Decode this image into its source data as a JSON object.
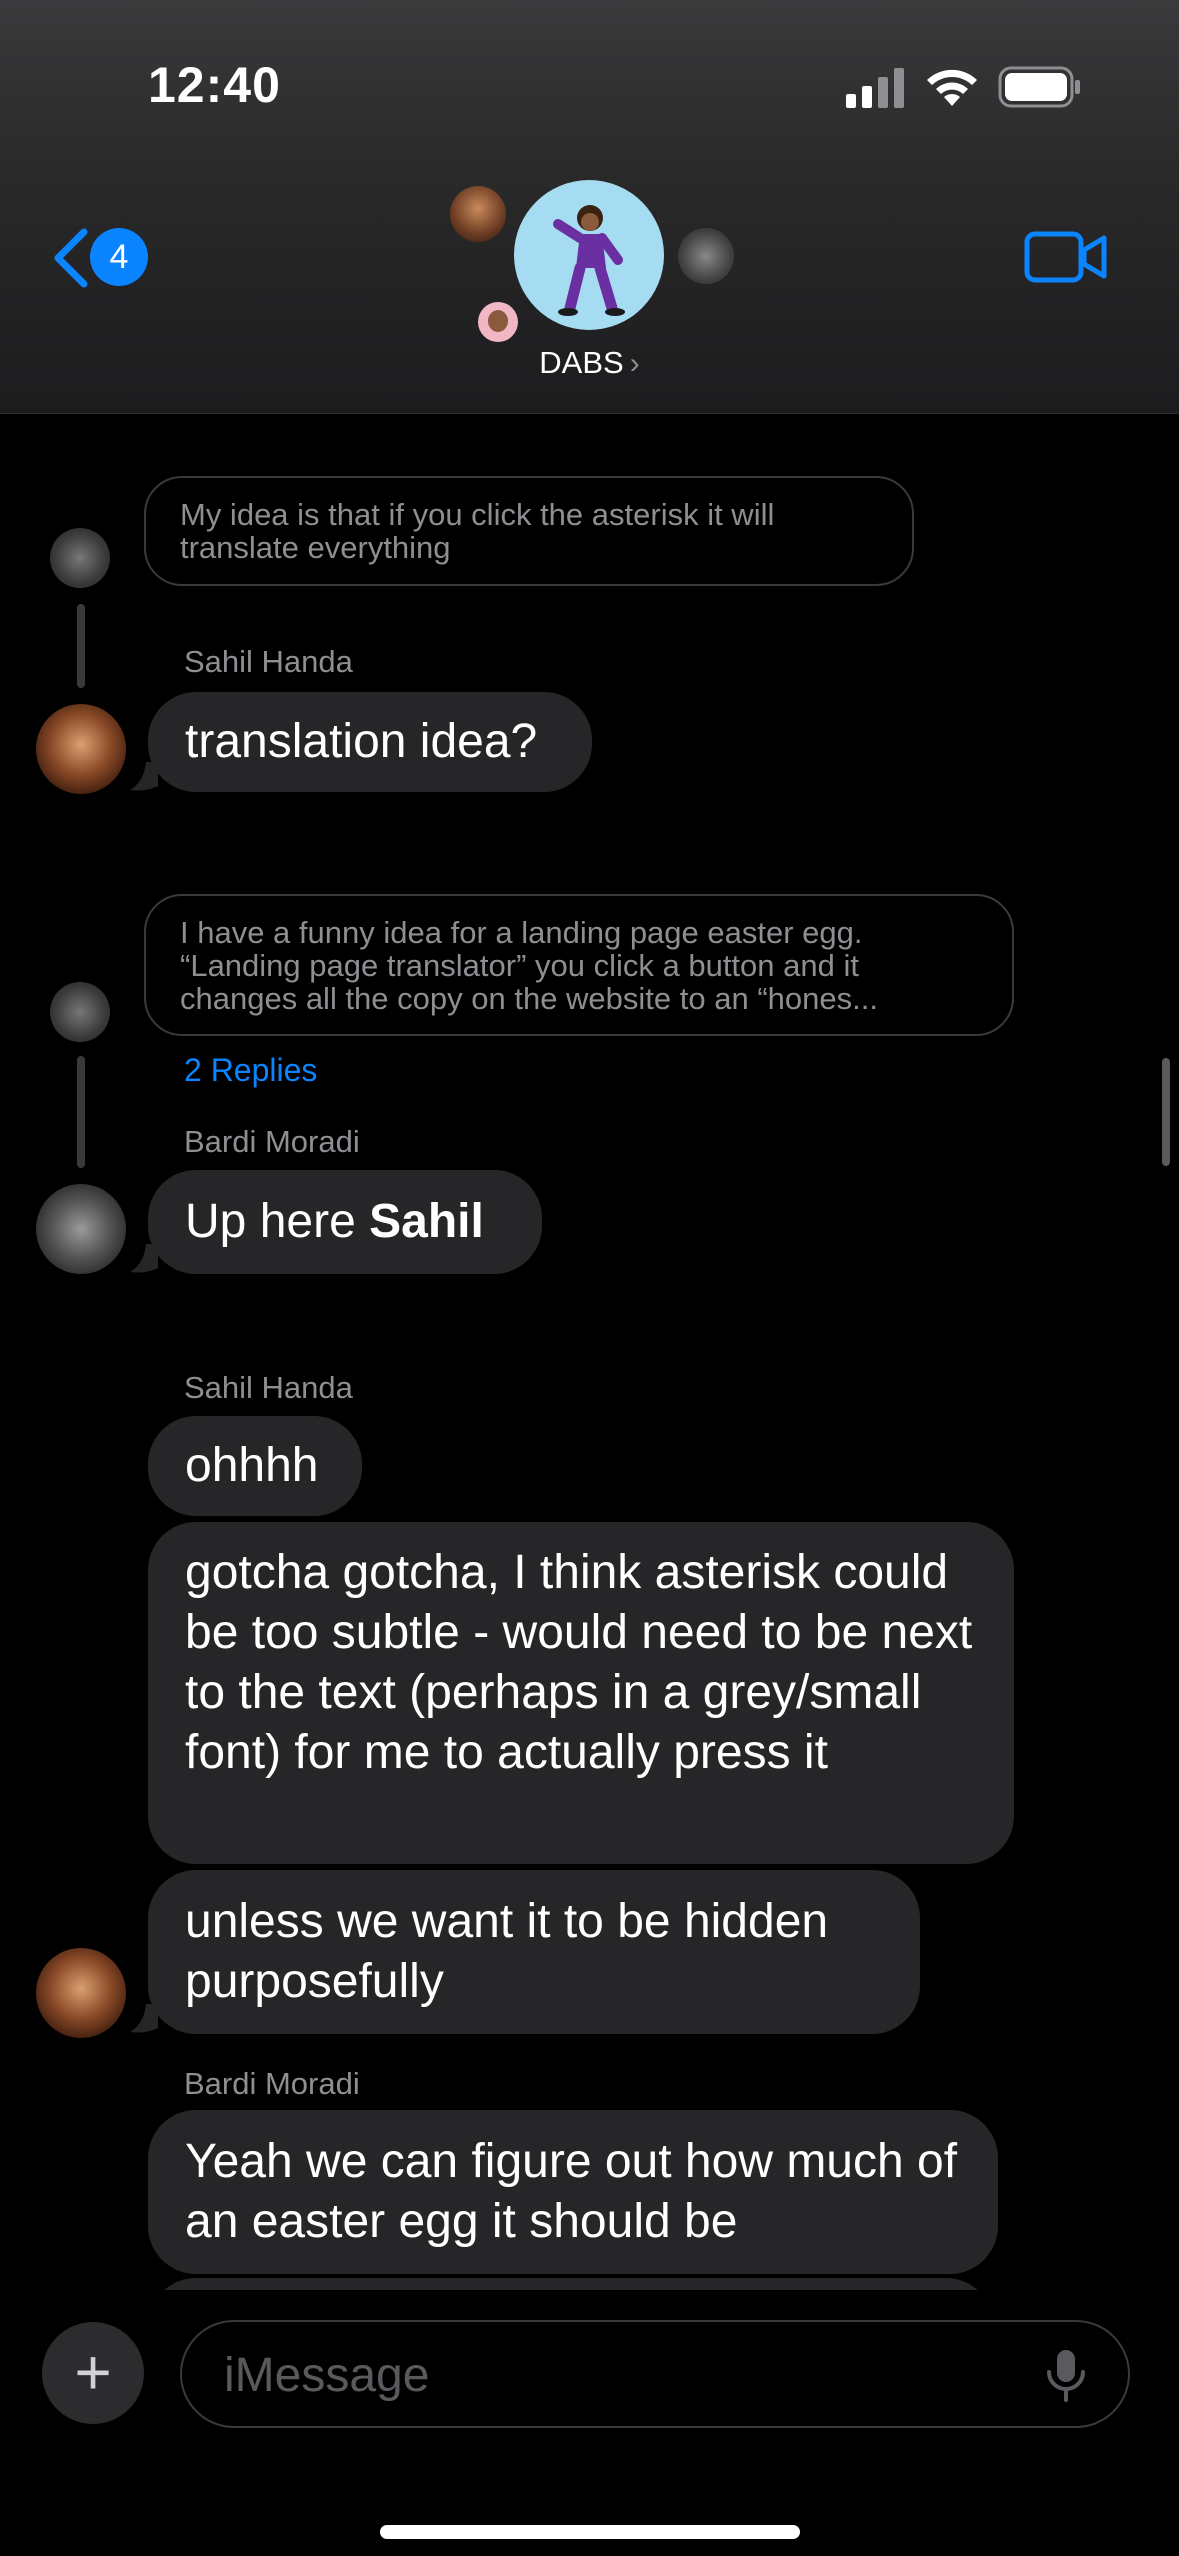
{
  "status_bar": {
    "time": "12:40"
  },
  "header": {
    "back_badge_count": "4",
    "group_name": "DABS",
    "chevron": "›",
    "back_icon": "chevron-left-icon",
    "video_icon": "video-camera-icon"
  },
  "messages": {
    "reply1_text": "My idea is that if you click the asterisk it will translate everything",
    "sender1": "Sahil  Handa",
    "msg1": "translation idea?",
    "reply2_text": "I have a funny idea for a landing page easter egg. “Landing page translator” you click a button and it changes all the copy on the website to an “hones...",
    "replies_link": "2 Replies",
    "sender2": "Bardi Moradi",
    "msg2_prefix": "Up here ",
    "msg2_bold": "Sahil",
    "sender3": "Sahil  Handa",
    "msg3": "ohhhh",
    "msg4": "gotcha gotcha, I think asterisk could be too subtle - would need to be next to the text (perhaps in a grey/small font) for me to actually press it",
    "msg5": "unless we want it to be hidden purposefully",
    "sender4": "Bardi Moradi",
    "msg6": "Yeah we can figure out how much of an easter egg it should be"
  },
  "composer": {
    "placeholder": "iMessage",
    "plus_label": "+"
  },
  "colors": {
    "accent": "#0a84ff",
    "bubble": "#262628",
    "background": "#000000"
  }
}
